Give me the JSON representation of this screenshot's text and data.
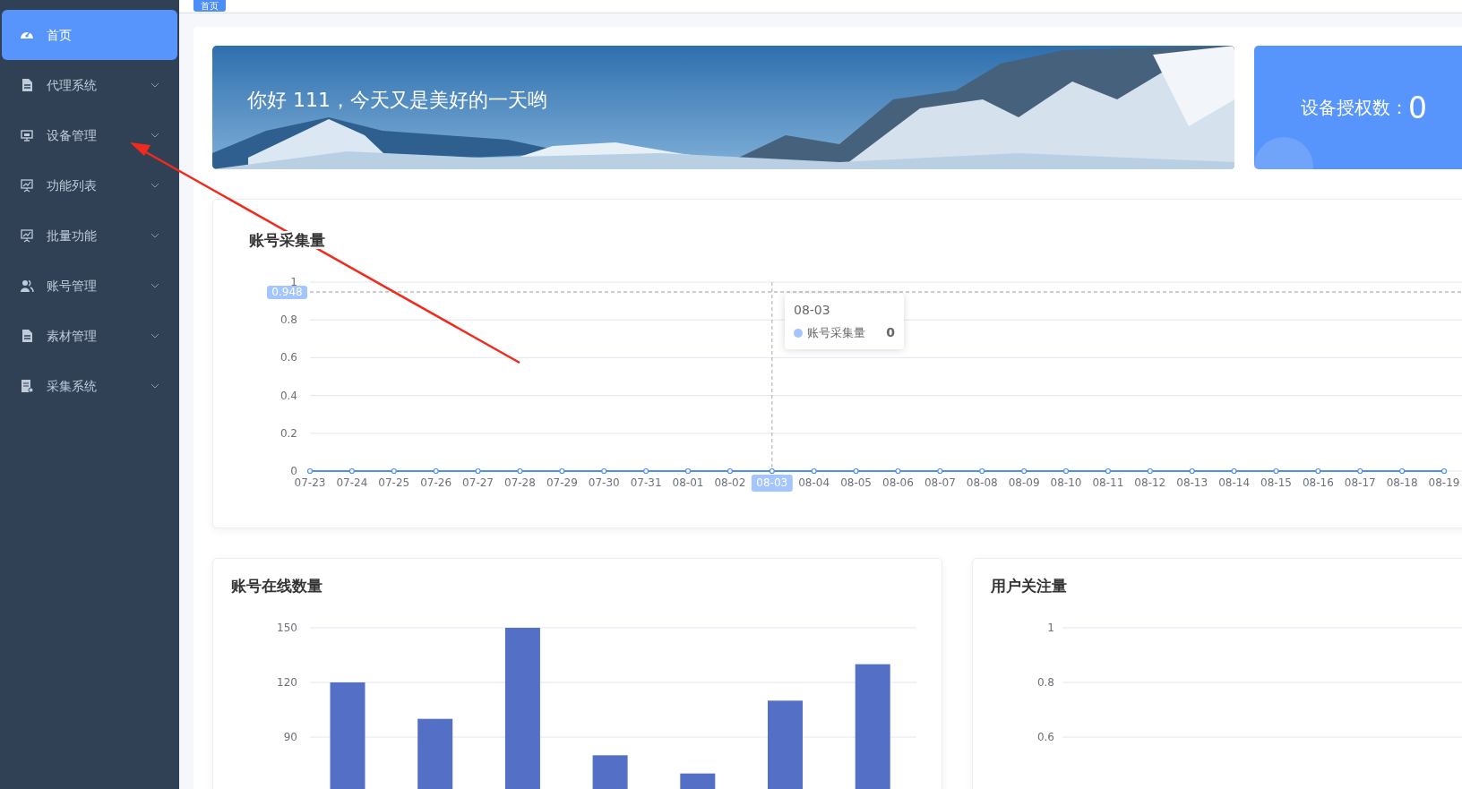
{
  "breadcrumb": [
    {
      "label": "首页",
      "selected": true
    }
  ],
  "sidebar": {
    "items": [
      {
        "label": "首页",
        "selected": true,
        "kind": "dashboard",
        "submenu": false
      },
      {
        "label": "代理系统",
        "selected": false,
        "kind": "document",
        "submenu": true
      },
      {
        "label": "设备管理",
        "selected": false,
        "kind": "monitor",
        "submenu": true
      },
      {
        "label": "功能列表",
        "selected": false,
        "kind": "board",
        "submenu": true
      },
      {
        "label": "批量功能",
        "selected": false,
        "kind": "board",
        "submenu": true
      },
      {
        "label": "账号管理",
        "selected": false,
        "kind": "users",
        "submenu": true
      },
      {
        "label": "素材管理",
        "selected": false,
        "kind": "document",
        "submenu": true
      },
      {
        "label": "采集系统",
        "selected": false,
        "kind": "archive",
        "submenu": true
      }
    ]
  },
  "banner": {
    "greeting": "你好 111，今天又是美好的一天哟",
    "kind": "picture"
  },
  "stat_card": {
    "label": "设备授权数：",
    "value": "0"
  },
  "collect_chart": {
    "title": "账号采集量",
    "tooltip": {
      "title": "08-03",
      "value": "0",
      "color": "#a4c5fd"
    },
    "chart_data": {
      "type": "line",
      "grid": true,
      "categories": [
        "07-23",
        "07-24",
        "07-25",
        "07-26",
        "07-27",
        "07-28",
        "07-29",
        "07-30",
        "07-31",
        "08-01",
        "08-02",
        "08-03",
        "08-04",
        "08-05",
        "08-06",
        "08-07",
        "08-08",
        "08-09",
        "08-10",
        "08-11",
        "08-12",
        "08-13",
        "08-14",
        "08-15",
        "08-16",
        "08-17",
        "08-18",
        "08-19"
      ],
      "series": [
        {
          "name": "账号采集量",
          "color": "#4e8ef7",
          "marker": "circle",
          "values": [
            0,
            0,
            0,
            0,
            0,
            0,
            0,
            0,
            0,
            0,
            0,
            0,
            0,
            0,
            0,
            0,
            0,
            0,
            0,
            0,
            0,
            0,
            0,
            0,
            0,
            0,
            0,
            0
          ]
        }
      ],
      "ylim": [
        0,
        1
      ],
      "yticks": [
        0,
        0.2,
        0.4,
        0.6,
        0.8,
        1
      ],
      "ref_lines": [
        {
          "axis": "y",
          "value": 0.948,
          "label": "0.948"
        },
        {
          "axis": "x",
          "value": "08-03"
        }
      ]
    }
  },
  "online_chart": {
    "title": "账号在线数量",
    "chart_data": {
      "type": "bar",
      "grid": true,
      "series": [
        {
          "color": "#5470c6",
          "values": [
            120,
            100,
            150,
            80,
            70,
            110,
            130
          ]
        }
      ],
      "ylim": [
        0,
        150
      ],
      "yticks": [
        90,
        120,
        150
      ]
    }
  },
  "follow_chart": {
    "title": "用户关注量",
    "axis_labels": [
      "1",
      "0.8",
      "0.6"
    ]
  }
}
